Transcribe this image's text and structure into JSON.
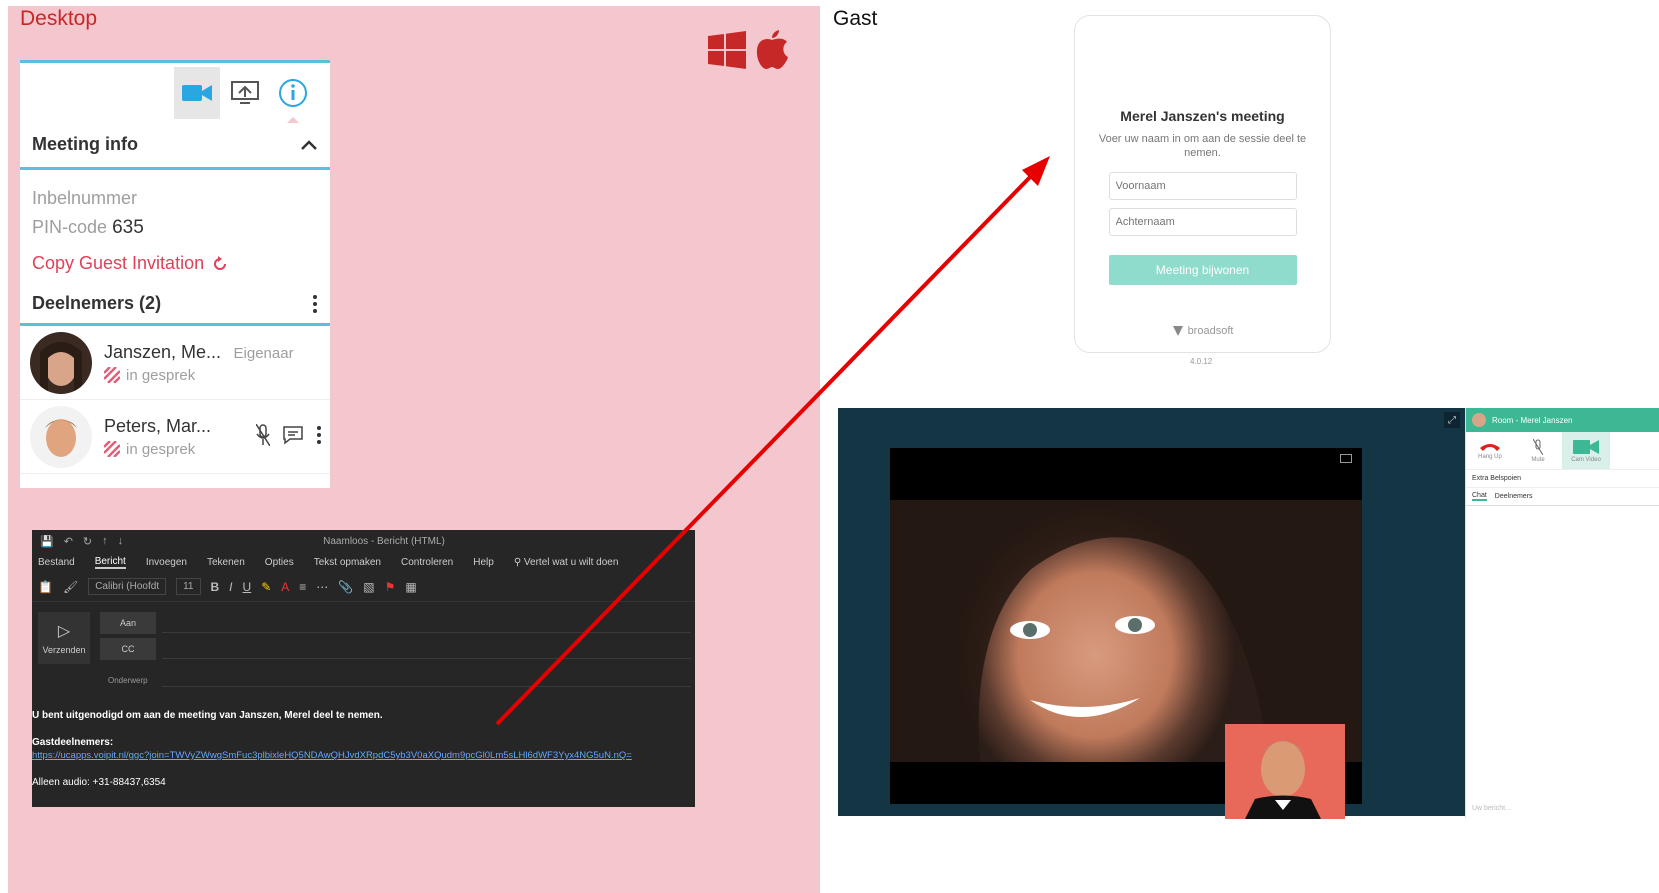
{
  "desktop": {
    "title": "Desktop",
    "meeting_info": {
      "header": "Meeting info",
      "dial_in": "Inbelnummer",
      "pin_label": "PIN-code",
      "pin_value": "635",
      "copy_invite": "Copy Guest Invitation",
      "participants_header": "Deelnemers (2)",
      "participants": [
        {
          "name": "Janszen, Me...",
          "role": "Eigenaar",
          "status": "in gesprek"
        },
        {
          "name": "Peters, Mar...",
          "role": "",
          "status": "in gesprek"
        }
      ]
    },
    "mail": {
      "window_title": "Naamloos - Bericht (HTML)",
      "tabs": [
        "Bestand",
        "Bericht",
        "Invoegen",
        "Tekenen",
        "Opties",
        "Tekst opmaken",
        "Controleren",
        "Help",
        "Vertel wat u wilt doen"
      ],
      "font_name": "Calibri (Hoofdt",
      "font_size": "11",
      "send_label": "Verzenden",
      "to_label": "Aan",
      "cc_label": "CC",
      "subject_label": "Onderwerp",
      "body_intro": "U bent uitgenodigd om aan de meeting van Janszen, Merel deel te nemen.",
      "guests_label": "Gastdeelnemers:",
      "guest_link": "https://ucapps.voipit.nl/ggc?join=TWVyZWwgSmFuc3plbixleHQ5NDAwQHJvdXRpdC5yb3V0aXQudm9pcGl0Lm5sLHl6dWF3Yyx4NG5uN.nQ=",
      "audio_line": "Alleen audio: +31-88437,6354"
    }
  },
  "guest": {
    "title": "Gast",
    "join": {
      "meeting_title": "Merel Janszen's meeting",
      "instruction": "Voer uw naam in om aan de sessie deel te nemen.",
      "first_name_placeholder": "Voornaam",
      "last_name_placeholder": "Achternaam",
      "join_button": "Meeting bijwonen",
      "brand": "broadsoft",
      "version": "4.0.12"
    },
    "call": {
      "room_title": "Room - Merel Janszen",
      "controls": [
        "Hang Up",
        "Mute",
        "Cam Video"
      ],
      "reception": "Extra Belspoien",
      "tabs": [
        "Chat",
        "Deelnemers"
      ],
      "message_placeholder": "Uw bericht..."
    }
  },
  "colors": {
    "pink_panel": "#f4c6cd",
    "accent_red": "#c62828",
    "teal": "#3db894",
    "arrow": "#e60000"
  }
}
